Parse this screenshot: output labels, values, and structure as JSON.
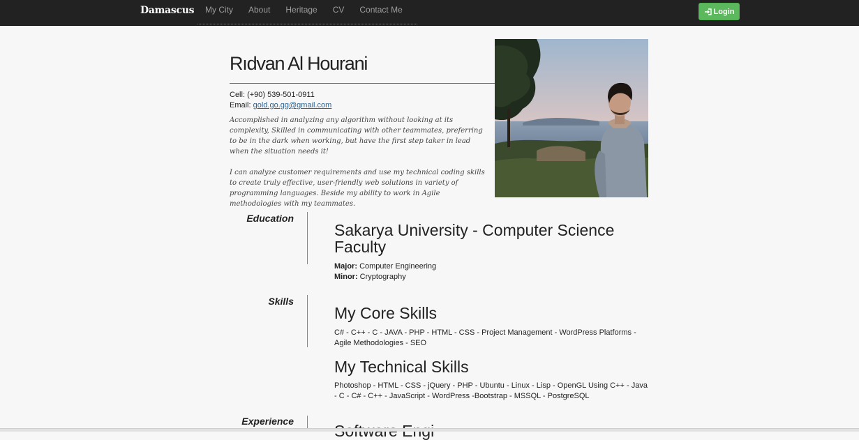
{
  "navbar": {
    "brand": "Damascus",
    "links": [
      "My City",
      "About",
      "Heritage",
      "CV",
      "Contact Me"
    ],
    "login_label": "Login",
    "login_color": "#5cb85c",
    "background": "#222222"
  },
  "profile": {
    "name": "Rıdvan Al Hourani",
    "cell_label": "Cell:",
    "cell_value": "(+90) 539-501-0911",
    "email_label": "Email:",
    "email_value": "gold.go.gg@gmail.com",
    "bio_1": "Accomplished in analyzing any algorithm without looking at its complexity, Skilled in communicating with other teammates, preferring to be in the dark when working, but have the first step taker in lead when the situation needs it!",
    "bio_2": "I can analyze customer requirements and use my technical coding skills to create truly effective, user-friendly web solutions in variety of programming languages. Beside my ability to work in Agile methodologies with my teammates."
  },
  "education": {
    "section_title": "Education",
    "school": "Sakarya University - Computer Science Faculty",
    "major_label": "Major:",
    "major_value": "Computer Engineering",
    "minor_label": "Minor:",
    "minor_value": "Cryptography"
  },
  "skills": {
    "section_title": "Skills",
    "core_title": "My Core Skills",
    "core_list": "C# - C++ - C - JAVA - PHP - HTML - CSS - Project Management - WordPress Platforms - Agile Methodologies - SEO",
    "tech_title": "My Technical Skills",
    "tech_list": "Photoshop - HTML - CSS - jQuery - PHP - Ubuntu - Linux - Lisp - OpenGL Using C++ - Java - C - C# - C++ - JavaScript - WordPress -Bootstrap - MSSQL - PostgreSQL"
  },
  "experience": {
    "section_title": "Experience",
    "first_job_title_partial": "Software Engi"
  },
  "icons": {
    "login": "sign-in-icon",
    "photo": "profile-photo"
  }
}
